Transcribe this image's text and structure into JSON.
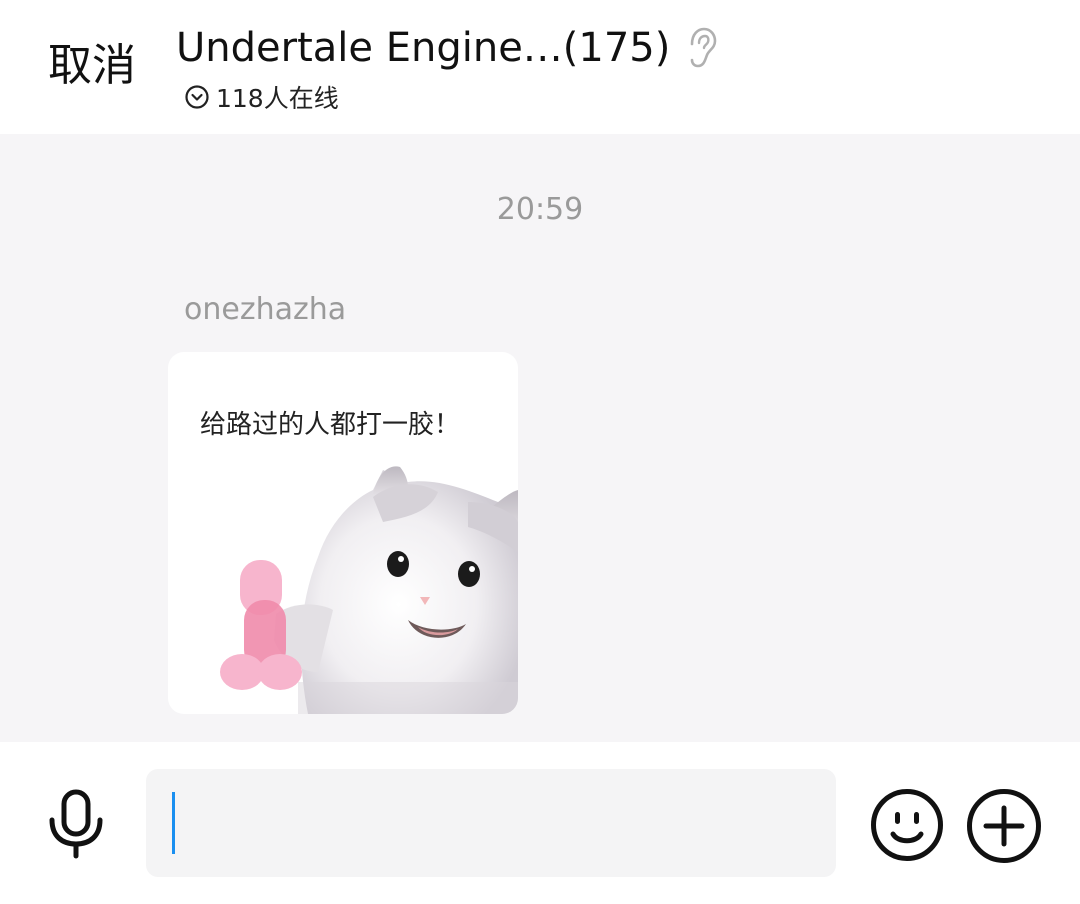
{
  "header": {
    "cancel_label": "取消",
    "title": "Undertale Engine…(175)",
    "online_text": "118人在线",
    "icons": {
      "ear": "ear-icon",
      "online": "chevron-down-circle-icon"
    }
  },
  "chat": {
    "timestamp": "20:59",
    "messages": [
      {
        "sender": "onezhazha",
        "type": "sticker",
        "sticker_caption": "给路过的人都打一胶！"
      }
    ]
  },
  "composer": {
    "input_value": "",
    "icons": {
      "voice": "microphone-icon",
      "emoji": "smiley-icon",
      "more": "plus-circle-icon"
    }
  },
  "colors": {
    "caret": "#1a8ff0",
    "chat_background": "#f6f5f7",
    "timestamp_text": "#9a9a9a"
  }
}
